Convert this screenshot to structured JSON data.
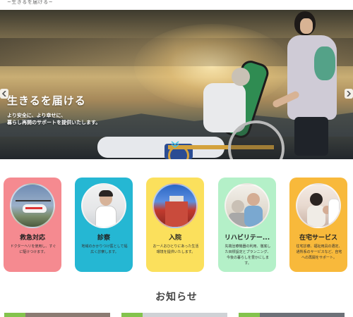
{
  "header": {
    "tagline": "~生きるを届ける~"
  },
  "hero": {
    "title": "生きるを届ける",
    "subtitle_line1": "より安全に、より幸せに、",
    "subtitle_line2": "暮らし再開のサポートを提供いたします。",
    "prev_icon": "chevron-left-icon",
    "next_icon": "chevron-right-icon",
    "scroll_icon": "double-chevron-down-icon"
  },
  "services": [
    {
      "title": "救急対応",
      "desc": "ドクターヘリを使用し、すぐに駆けつけます。",
      "color": "#f58a90"
    },
    {
      "title": "診察",
      "desc": "地域のかかりつけ医として幅広く診察します。",
      "color": "#25b7d3"
    },
    {
      "title": "入院",
      "desc": "お一人おひとりにあった生活環境を提供いたします。",
      "color": "#fbe05c"
    },
    {
      "title": "リハビリテー...",
      "desc": "先端治療機器の利用、徹底した目標設定とプランニング、今後の暮らしを豊かにします。",
      "color": "#b4f0c8"
    },
    {
      "title": "在宅サービス",
      "desc": "往宅診療、福祉用具の選定、通所系のサービスなど、自宅への再開をサポート。",
      "color": "#f8b93b"
    }
  ],
  "news": {
    "heading": "お知らせ"
  }
}
